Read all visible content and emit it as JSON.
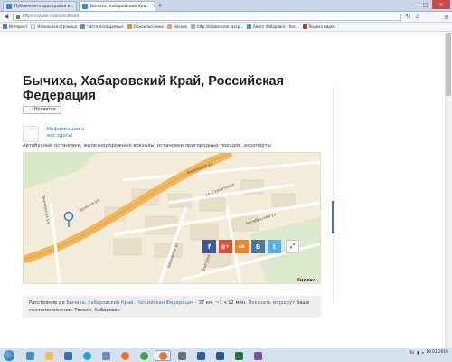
{
  "browser": {
    "tabs": [
      {
        "label": "Публичная кадастровая к...",
        "active": false,
        "favicon_color": "#3c7bd6"
      },
      {
        "label": "Бычиха, Хабаровский Кра...",
        "active": true,
        "favicon_color": "#2f8ad8"
      }
    ],
    "new_tab_glyph": "+",
    "url": "https://vasee.ru/place/36544",
    "bookmarks": [
      {
        "label": "Интернет",
        "color": "#3c7bd6"
      },
      {
        "label": "Начальная страница",
        "color": "#e9e9e9"
      },
      {
        "label": "Часто посещаемые",
        "color": "#5b8bd0"
      },
      {
        "label": "Одноклассники",
        "color": "#f08a1c"
      },
      {
        "label": "Начало",
        "color": "#f0a640"
      },
      {
        "label": "http://khabarovsk.fassp...",
        "color": "#8db3d9"
      },
      {
        "label": "Авито Хабаровск - бес...",
        "color": "#3fa0d9"
      },
      {
        "label": "Яндекс видео",
        "color": "#e0261a"
      }
    ]
  },
  "page": {
    "title": "Бычиха, Хабаровский Край, Российская Федерация",
    "like_label": "Нравится",
    "info_text": "Информации о вас здесь!",
    "description": "Автобусные остановки, железнодорожные вокзалы, остановки пригородных поездов, аэропорты",
    "map": {
      "street_labels": [
        "Березовая ул.",
        "ул. Строителей",
        "Октябрьская ул.",
        "Зелёная ул.",
        "Школьная ул.",
        "Пионерская ул.",
        "Быстрая ул."
      ],
      "share_buttons": [
        {
          "name": "facebook",
          "glyph": "f",
          "color": "#3b5998"
        },
        {
          "name": "google-plus",
          "glyph": "g+",
          "color": "#dd4b39"
        },
        {
          "name": "odnoklassniki",
          "glyph": "ok",
          "color": "#f58220"
        },
        {
          "name": "vkontakte",
          "glyph": "B",
          "color": "#4c75a3"
        },
        {
          "name": "twitter",
          "glyph": "t",
          "color": "#55acee"
        }
      ],
      "fullscreen_glyph": "⤢",
      "provider_prefix": "Я",
      "provider_rest": "ндекс"
    },
    "footer": {
      "prefix": "Расстояние до ",
      "place_link": "Бычиха, Хабаровский Край, Российская Федерация",
      "distance": " - 37 км, ~1 ч 12 мин. ",
      "route_link": "Показать маршрут",
      "location": " Ваше местоположение: Россия, Хабаровск"
    }
  },
  "taskbar": {
    "apps": [
      {
        "name": "ie",
        "color": "#3b8fd6"
      },
      {
        "name": "explorer",
        "color": "#e8c15a"
      },
      {
        "name": "media",
        "color": "#3a6fbf"
      },
      {
        "name": "skype",
        "color": "#1ea0e0"
      },
      {
        "name": "app5",
        "color": "#6d8fb4"
      },
      {
        "name": "firefox",
        "color": "#e8742a"
      },
      {
        "name": "chrome",
        "color": "#3da44a"
      },
      {
        "name": "app8",
        "color": "#6b6b6b"
      },
      {
        "name": "photo",
        "color": "#2f5fa8"
      },
      {
        "name": "word",
        "color": "#2b5797"
      },
      {
        "name": "excel",
        "color": "#207245"
      },
      {
        "name": "app12",
        "color": "#7a4fb0"
      }
    ],
    "lang": "RU",
    "date": "19.01.2016"
  }
}
